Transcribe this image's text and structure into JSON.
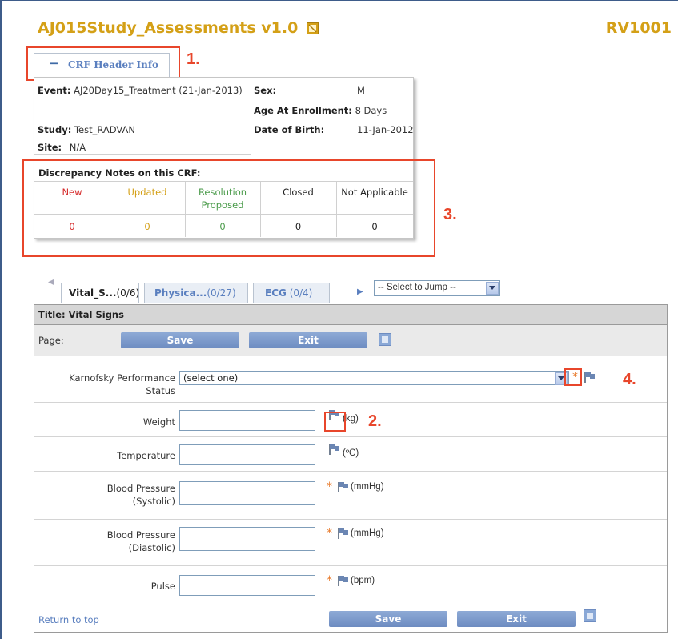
{
  "header": {
    "title": "AJ015Study_Assessments v1.0",
    "subject_id": "RV1001"
  },
  "crf_header_tab": {
    "toggle": "−",
    "label": "CRF Header Info"
  },
  "crf_info": {
    "event_label": "Event:",
    "event_value": "AJ20Day15_Treatment (21-Jan-2013)",
    "study_label": "Study:",
    "study_value": "Test_RADVAN",
    "site_label": "Site:",
    "site_value": "N/A",
    "sex_label": "Sex:",
    "sex_value": "M",
    "age_label": "Age At Enrollment:",
    "age_value": "8 Days",
    "dob_label": "Date of Birth:",
    "dob_value": "11-Jan-2012"
  },
  "discrepancy": {
    "title": "Discrepancy Notes on this CRF:",
    "columns": [
      {
        "label": "New",
        "label2": "",
        "count": "0",
        "color": "#d62b2b"
      },
      {
        "label": "Updated",
        "label2": "",
        "count": "0",
        "color": "#d4a017"
      },
      {
        "label": "Resolution",
        "label2": "Proposed",
        "count": "0",
        "color": "#4b9b4b"
      },
      {
        "label": "Closed",
        "label2": "",
        "count": "0",
        "color": "#222222"
      },
      {
        "label": "Not Applicable",
        "label2": "",
        "count": "0",
        "color": "#222222"
      }
    ]
  },
  "annotations": {
    "a1": "1.",
    "a2": "2.",
    "a3": "3.",
    "a4": "4."
  },
  "section_tabs": [
    {
      "label": "Vital_S...",
      "count": "(0/6)"
    },
    {
      "label": "Physica...",
      "count": "(0/27)"
    },
    {
      "label": "ECG",
      "count": "(0/4)"
    }
  ],
  "jump_select": {
    "selected": "-- Select to Jump --"
  },
  "form": {
    "title": "Title: Vital Signs",
    "page_label": "Page:",
    "save_label": "Save",
    "exit_label": "Exit",
    "return_to_top": "Return to top",
    "fields": {
      "karnofsky_label_1": "Karnofsky Performance",
      "karnofsky_label_2": "Status",
      "karnofsky_value": "(select one)",
      "weight_label": "Weight",
      "weight_unit": "(kg)",
      "temperature_label": "Temperature",
      "temperature_unit": "(ºC)",
      "bp_sys_label_1": "Blood Pressure",
      "bp_sys_label_2": "(Systolic)",
      "bp_sys_unit": "(mmHg)",
      "bp_dia_label_1": "Blood Pressure",
      "bp_dia_label_2": "(Diastolic)",
      "bp_dia_unit": "(mmHg)",
      "pulse_label": "Pulse",
      "pulse_unit": "(bpm)",
      "required_mark": "*"
    }
  },
  "colors": {
    "title_gold": "#d4a017",
    "annotation_red": "#e8462b",
    "button_blue": "#7a98cb",
    "link_blue": "#5a7fbf",
    "required_orange": "#e87a2b"
  }
}
